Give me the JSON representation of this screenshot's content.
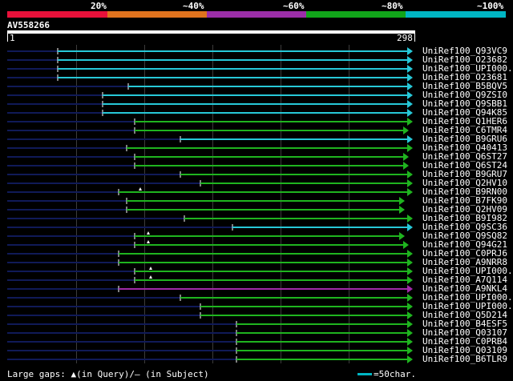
{
  "colors": {
    "legend": [
      "#e8113a",
      "#e0731e",
      "#9b2ea8",
      "#11a51a",
      "#00b6c4"
    ],
    "cyan": "#27c8d8",
    "green": "#1fb41f",
    "purple": "#a02aa8",
    "navy": "#101a58",
    "gap_marker": "#ffffff"
  },
  "legend": {
    "labels": [
      "20%",
      "~40%",
      "~60%",
      "~80%",
      "~100%"
    ]
  },
  "query": {
    "name": "AV558266",
    "start": "1",
    "end": "298"
  },
  "hits": [
    {
      "name": "UniRef100_Q93VC9",
      "color": "cyan"
    },
    {
      "name": "UniRef100_O23682",
      "color": "cyan"
    },
    {
      "name": "UniRef100_UPI000..",
      "color": "cyan"
    },
    {
      "name": "UniRef100_O23681",
      "color": "cyan"
    },
    {
      "name": "UniRef100_B5BQV5",
      "color": "cyan"
    },
    {
      "name": "UniRef100_Q9ZSI0",
      "color": "cyan"
    },
    {
      "name": "UniRef100_Q9SBB1",
      "color": "cyan"
    },
    {
      "name": "UniRef100_Q94K85",
      "color": "cyan"
    },
    {
      "name": "UniRef100_Q1HER6",
      "color": "green"
    },
    {
      "name": "UniRef100_C6TMR4",
      "color": "green"
    },
    {
      "name": "UniRef100_B9GRU6",
      "color": "cyan"
    },
    {
      "name": "UniRef100_Q40413",
      "color": "green"
    },
    {
      "name": "UniRef100_Q6ST27",
      "color": "green"
    },
    {
      "name": "UniRef100_Q6ST24",
      "color": "green"
    },
    {
      "name": "UniRef100_B9GRU7",
      "color": "green"
    },
    {
      "name": "UniRef100_Q2HV10",
      "color": "green"
    },
    {
      "name": "UniRef100_B9RN00",
      "color": "green"
    },
    {
      "name": "UniRef100_B7FK90",
      "color": "green"
    },
    {
      "name": "UniRef100_Q2HV09",
      "color": "green"
    },
    {
      "name": "UniRef100_B9I982",
      "color": "green"
    },
    {
      "name": "UniRef100_Q9SC36",
      "color": "cyan"
    },
    {
      "name": "UniRef100_Q9SQ82",
      "color": "green"
    },
    {
      "name": "UniRef100_Q94G21",
      "color": "green"
    },
    {
      "name": "UniRef100_C0PRJ6",
      "color": "green"
    },
    {
      "name": "UniRef100_A9NRR8",
      "color": "green"
    },
    {
      "name": "UniRef100_UPI000..",
      "color": "green"
    },
    {
      "name": "UniRef100_A7Q114",
      "color": "green"
    },
    {
      "name": "UniRef100_A9NKL4",
      "color": "purple"
    },
    {
      "name": "UniRef100_UPI000..",
      "color": "green"
    },
    {
      "name": "UniRef100_UPI000..",
      "color": "green"
    },
    {
      "name": "UniRef100_Q5D214",
      "color": "green"
    },
    {
      "name": "UniRef100_B4ESF5",
      "color": "green"
    },
    {
      "name": "UniRef100_Q03107",
      "color": "green"
    },
    {
      "name": "UniRef100_C0PRB4",
      "color": "green"
    },
    {
      "name": "UniRef100_Q03109",
      "color": "green"
    },
    {
      "name": "UniRef100_B6TLR9",
      "color": "green"
    }
  ],
  "footer": {
    "gaps_text": "Large gaps: ▲(in Query)/– (in Subject)",
    "scale_text": "=50char."
  }
}
